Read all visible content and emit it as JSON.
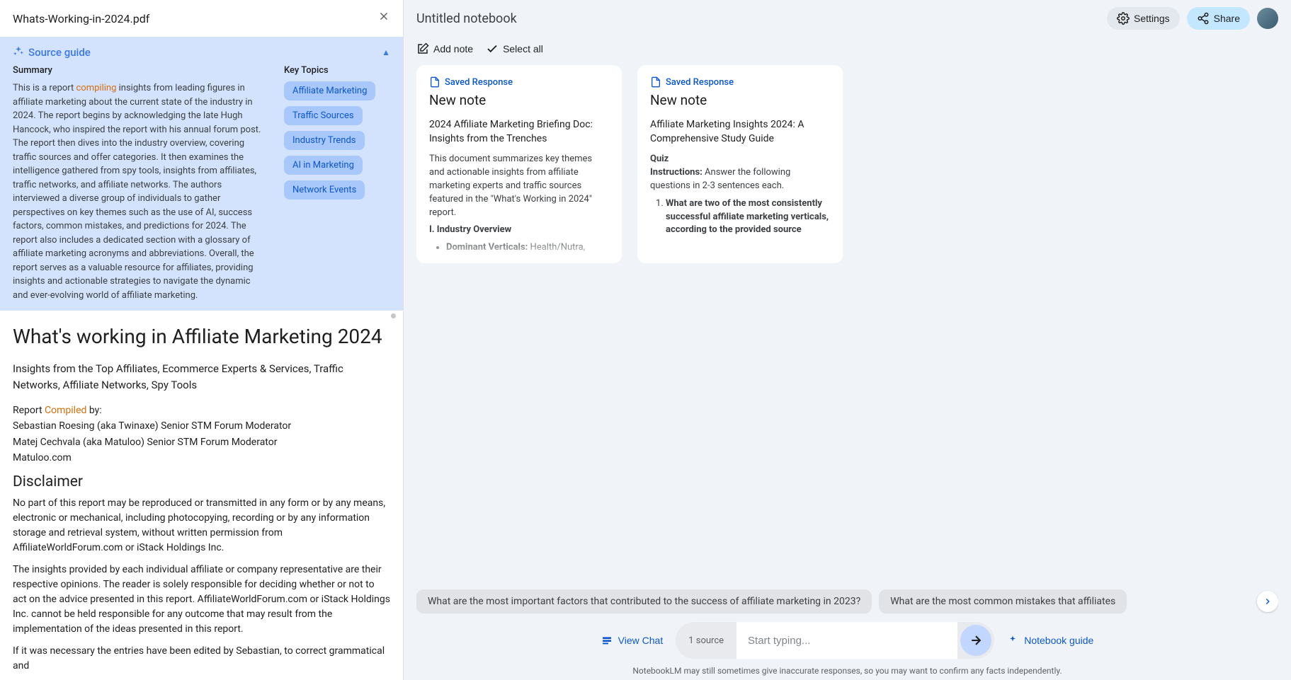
{
  "left": {
    "file_title": "Whats-Working-in-2024.pdf",
    "source_guide": {
      "title": "Source guide",
      "summary_label": "Summary",
      "summary_pre": "This is a report ",
      "summary_highlight": "compiling",
      "summary_post": " insights from leading figures in affiliate marketing about the current state of the industry in 2024. The report begins by acknowledging the late Hugh Hancock, who inspired the report with his annual forum post. The report then dives into the industry overview, covering traffic sources and offer categories. It then examines the intelligence gathered from spy tools, insights from affiliates, traffic networks, and affiliate networks. The authors interviewed a diverse group of individuals to gather perspectives on key themes such as the use of AI, success factors, common mistakes, and predictions for 2024. The report also includes a dedicated section with a glossary of affiliate marketing acronyms and abbreviations. Overall, the report serves as a valuable resource for affiliates, providing insights and actionable strategies to navigate the dynamic and ever-evolving world of affiliate marketing.",
      "key_topics_label": "Key Topics",
      "topics": [
        "Affiliate Marketing",
        "Traffic Sources",
        "Industry Trends",
        "AI in Marketing",
        "Network Events"
      ]
    },
    "doc": {
      "h1": "What's working in Affiliate Marketing 2024",
      "p1": "Insights from the Top Affiliates, Ecommerce Experts & Services, Traffic Networks, Affiliate Networks, Spy Tools",
      "compiled_pre": "Report ",
      "compiled_word": "Compiled",
      "compiled_post": " by:",
      "author1": "Sebastian Roesing (aka Twinaxe) Senior STM Forum Moderator",
      "author2": "Matej Cechvala (aka Matuloo) Senior STM Forum Moderator",
      "site": "Matuloo.com",
      "h2": "Disclaimer",
      "para1": "No part of this report may be reproduced or transmitted in any form or by any means, electronic or mechanical, including photocopying, recording or by any information storage and retrieval system, without written permission from AffiliateWorldForum.com or iStack Holdings Inc.",
      "para2": "The insights provided by each individual affiliate or company representative are their respective opinions. The reader is solely responsible for deciding whether or not to act on the advice presented in this report. AffiliateWorldForum.com or iStack Holdings Inc. cannot be held responsible for any outcome that may result from the implementation of the ideas presented in this report.",
      "para3": "If it was necessary the entries have been edited by Sebastian, to correct grammatical and"
    }
  },
  "right": {
    "title": "Untitled notebook",
    "settings": "Settings",
    "share": "Share",
    "add_note": "Add note",
    "select_all": "Select all",
    "notes": [
      {
        "badge": "Saved Response",
        "title": "New note",
        "heading": "2024 Affiliate Marketing Briefing Doc: Insights from the Trenches",
        "body": "This document summarizes key themes and actionable insights from affiliate marketing experts and traffic sources featured in the \"What's Working in 2024\" report.",
        "section": "I. Industry Overview",
        "bullet_label": "Dominant Verticals: ",
        "bullet_rest": "Health/Nutra,"
      },
      {
        "badge": "Saved Response",
        "title": "New note",
        "heading": "Affiliate Marketing Insights 2024: A Comprehensive Study Guide",
        "quiz_label": "Quiz",
        "instructions_label": "Instructions: ",
        "instructions_rest": "Answer the following questions in 2-3 sentences each.",
        "q1": "What are two of the most consistently successful affiliate marketing verticals, according to the provided source"
      }
    ]
  },
  "bottom": {
    "suggestions": [
      "What are the most important factors that contributed to the success of affiliate marketing in 2023?",
      "What are the most common mistakes that affiliates"
    ],
    "view_chat": "View Chat",
    "source_count": "1 source",
    "placeholder": "Start typing...",
    "nb_guide": "Notebook guide",
    "disclaimer": "NotebookLM may still sometimes give inaccurate responses, so you may want to confirm any facts independently."
  }
}
